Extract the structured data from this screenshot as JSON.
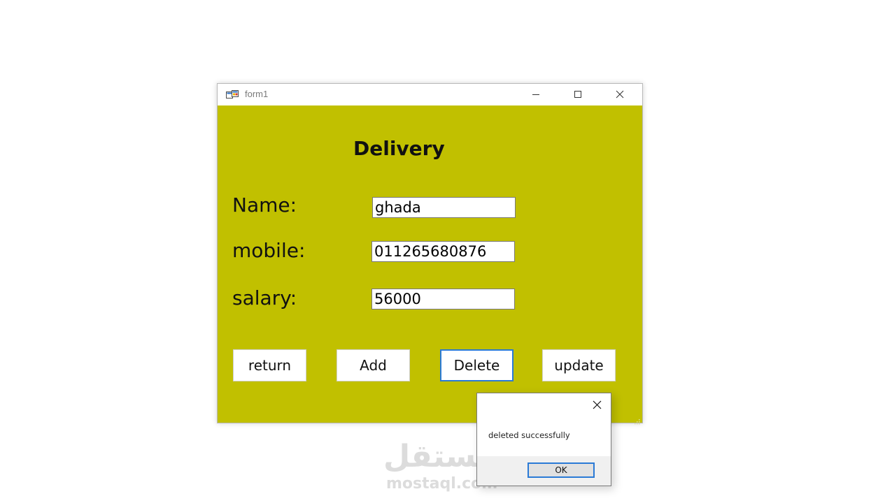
{
  "window": {
    "title": "form1",
    "icons": {
      "app": "winforms-app-icon",
      "minimize": "minimize-icon",
      "maximize": "maximize-icon",
      "close": "close-icon"
    }
  },
  "form": {
    "heading": "Delivery",
    "fields": [
      {
        "label": "Name:",
        "value": "ghada"
      },
      {
        "label": "mobile:",
        "value": "011265680876"
      },
      {
        "label": "salary:",
        "value": "56000"
      }
    ],
    "buttons": {
      "return": "return",
      "add": "Add",
      "delete": "Delete",
      "update": "update"
    },
    "background_color": "#c1c000"
  },
  "message_box": {
    "text": "deleted successfully",
    "ok_label": "OK",
    "accent_color": "#2a7ad6"
  },
  "watermark": {
    "arabic": "مستقل",
    "latin": "mostaql.com"
  }
}
